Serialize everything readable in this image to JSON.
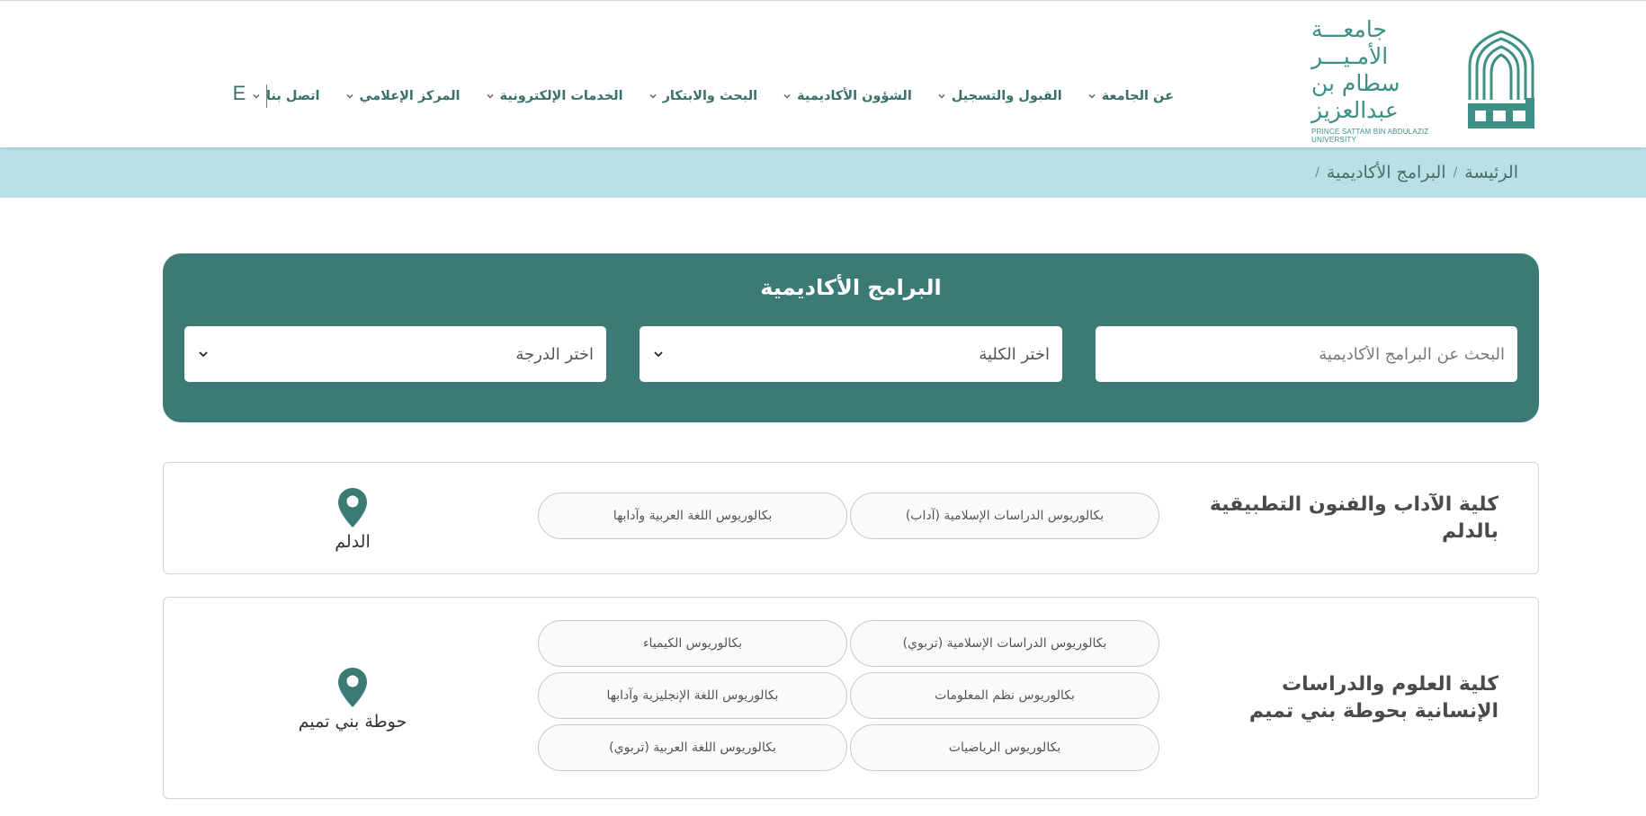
{
  "colors": {
    "accent": "#3c7a76",
    "breadcrumb_bg": "#b9e1e5",
    "nav_text": "#3a6f6c",
    "logo": "#3e8f86"
  },
  "logo": {
    "line1": "جامعـــة الأمـيـــر",
    "line2": "سطام بن عبدالعزيز",
    "line3": "PRINCE SATTAM BIN ABDULAZIZ UNIVERSITY"
  },
  "nav": {
    "items": [
      {
        "label": "عن الجامعة",
        "icon": "chevron-down-icon"
      },
      {
        "label": "القبول والتسجيل",
        "icon": "chevron-down-icon"
      },
      {
        "label": "الشؤون الأكاديمية",
        "icon": "chevron-down-icon"
      },
      {
        "label": "البحث والابتكار",
        "icon": "chevron-down-icon"
      },
      {
        "label": "الخدمات الإلكترونية",
        "icon": "chevron-down-icon"
      },
      {
        "label": "المركز الإعلامي",
        "icon": "chevron-down-icon"
      },
      {
        "label": "اتصل بنا",
        "icon": "chevron-down-icon"
      }
    ],
    "language": "E"
  },
  "breadcrumb": {
    "home": "الرئيسة",
    "current": "البرامج الأكاديمية",
    "separator": "/"
  },
  "search_panel": {
    "title": "البرامج الأكاديمية",
    "search_placeholder": "البحث عن البرامج الأكاديمية",
    "college_select": "اختر الكلية",
    "degree_select": "اختر الدرجة"
  },
  "colleges": [
    {
      "name": "كلية الآداب والفنون التطبيقية بالدلم",
      "location": "الدلم",
      "programs": [
        "بكالوريوس الدراسات الإسلامية (آداب)",
        "بكالوريوس اللغة العربية وآدابها"
      ]
    },
    {
      "name": "كلية العلوم والدراسات الإنسانية بحوطة بني تميم",
      "location": "حوطة بني تميم",
      "programs": [
        "بكالوريوس الدراسات الإسلامية (تربوي)",
        "بكالوريوس الكيمياء",
        "بكالوريوس نظم المعلومات",
        "بكالوريوس اللغة الإنجليزية وآدابها",
        "بكالوريوس الرياضيات",
        "بكالوريوس اللغة العربية (تربوي)"
      ]
    }
  ]
}
